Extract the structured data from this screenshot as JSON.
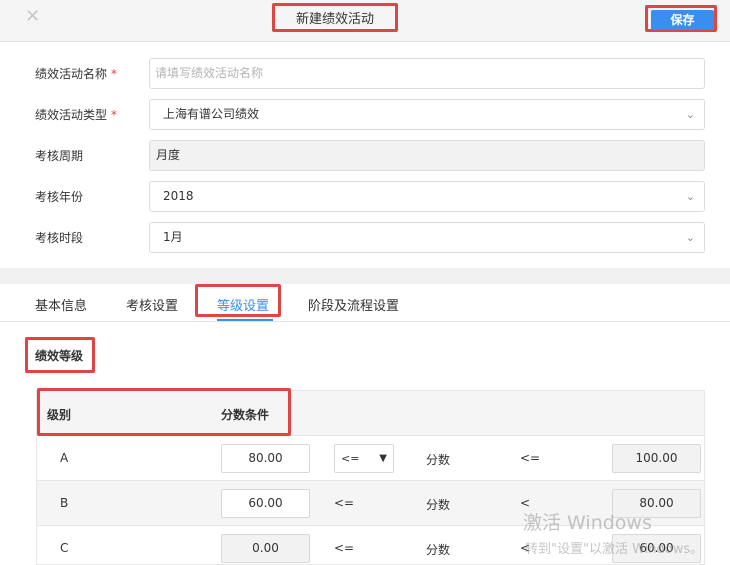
{
  "header": {
    "close_icon": "close-icon",
    "title": "新建绩效活动",
    "save_label": "保存"
  },
  "form": {
    "name": {
      "label": "绩效活动名称",
      "required": "*",
      "placeholder": "请填写绩效活动名称",
      "value": ""
    },
    "type": {
      "label": "绩效活动类型",
      "required": "*",
      "value": "上海有谱公司绩效"
    },
    "period": {
      "label": "考核周期",
      "value": "月度"
    },
    "year": {
      "label": "考核年份",
      "value": "2018"
    },
    "phase": {
      "label": "考核时段",
      "value": "1月"
    }
  },
  "tabs": [
    {
      "label": "基本信息"
    },
    {
      "label": "考核设置"
    },
    {
      "label": "等级设置",
      "active": true
    },
    {
      "label": "阶段及流程设置"
    }
  ],
  "section": {
    "title": "绩效等级"
  },
  "table": {
    "headers": {
      "level": "级别",
      "condition": "分数条件"
    },
    "rows": [
      {
        "level": "A",
        "min": "80.00",
        "op1": "<=",
        "score_label": "分数",
        "op2": "<=",
        "max": "100.00"
      },
      {
        "level": "B",
        "min": "60.00",
        "op1": "<=",
        "score_label": "分数",
        "op2": "<",
        "max": "80.00"
      },
      {
        "level": "C",
        "min": "0.00",
        "op1": "<=",
        "score_label": "分数",
        "op2": "<",
        "max": "60.00"
      }
    ]
  },
  "watermark": {
    "line1": "激活 Windows",
    "line2": "转到\"设置\"以激活 Windows。"
  },
  "colors": {
    "accent": "#3a8ef0",
    "highlight": "#e04545",
    "required": "#e04545"
  }
}
